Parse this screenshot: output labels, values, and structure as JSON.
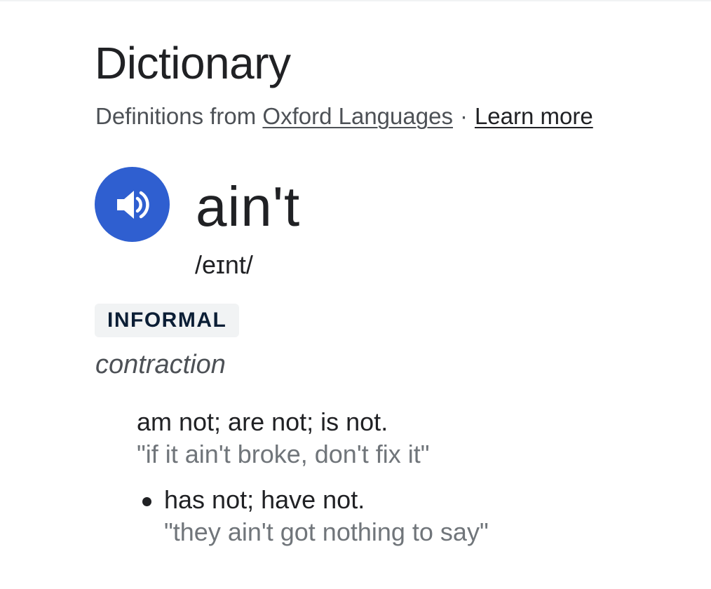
{
  "title": "Dictionary",
  "source": {
    "prefix": "Definitions from",
    "provider_link": "Oxford Languages",
    "separator": "·",
    "learn_more": "Learn more"
  },
  "entry": {
    "pronounce_button_icon": "speaker-icon",
    "word": "ain't",
    "phonetic": "/eɪnt/",
    "register_badge": "INFORMAL",
    "part_of_speech": "contraction",
    "definitions": [
      {
        "text": "am not; are not; is not.",
        "example": "\"if it ain't broke, don't fix it\""
      },
      {
        "text": "has not; have not.",
        "example": "\"they ain't got nothing to say\""
      }
    ]
  },
  "colors": {
    "accent": "#2f5fd0",
    "badge_bg": "#f1f3f4",
    "muted_text": "#70757a"
  }
}
